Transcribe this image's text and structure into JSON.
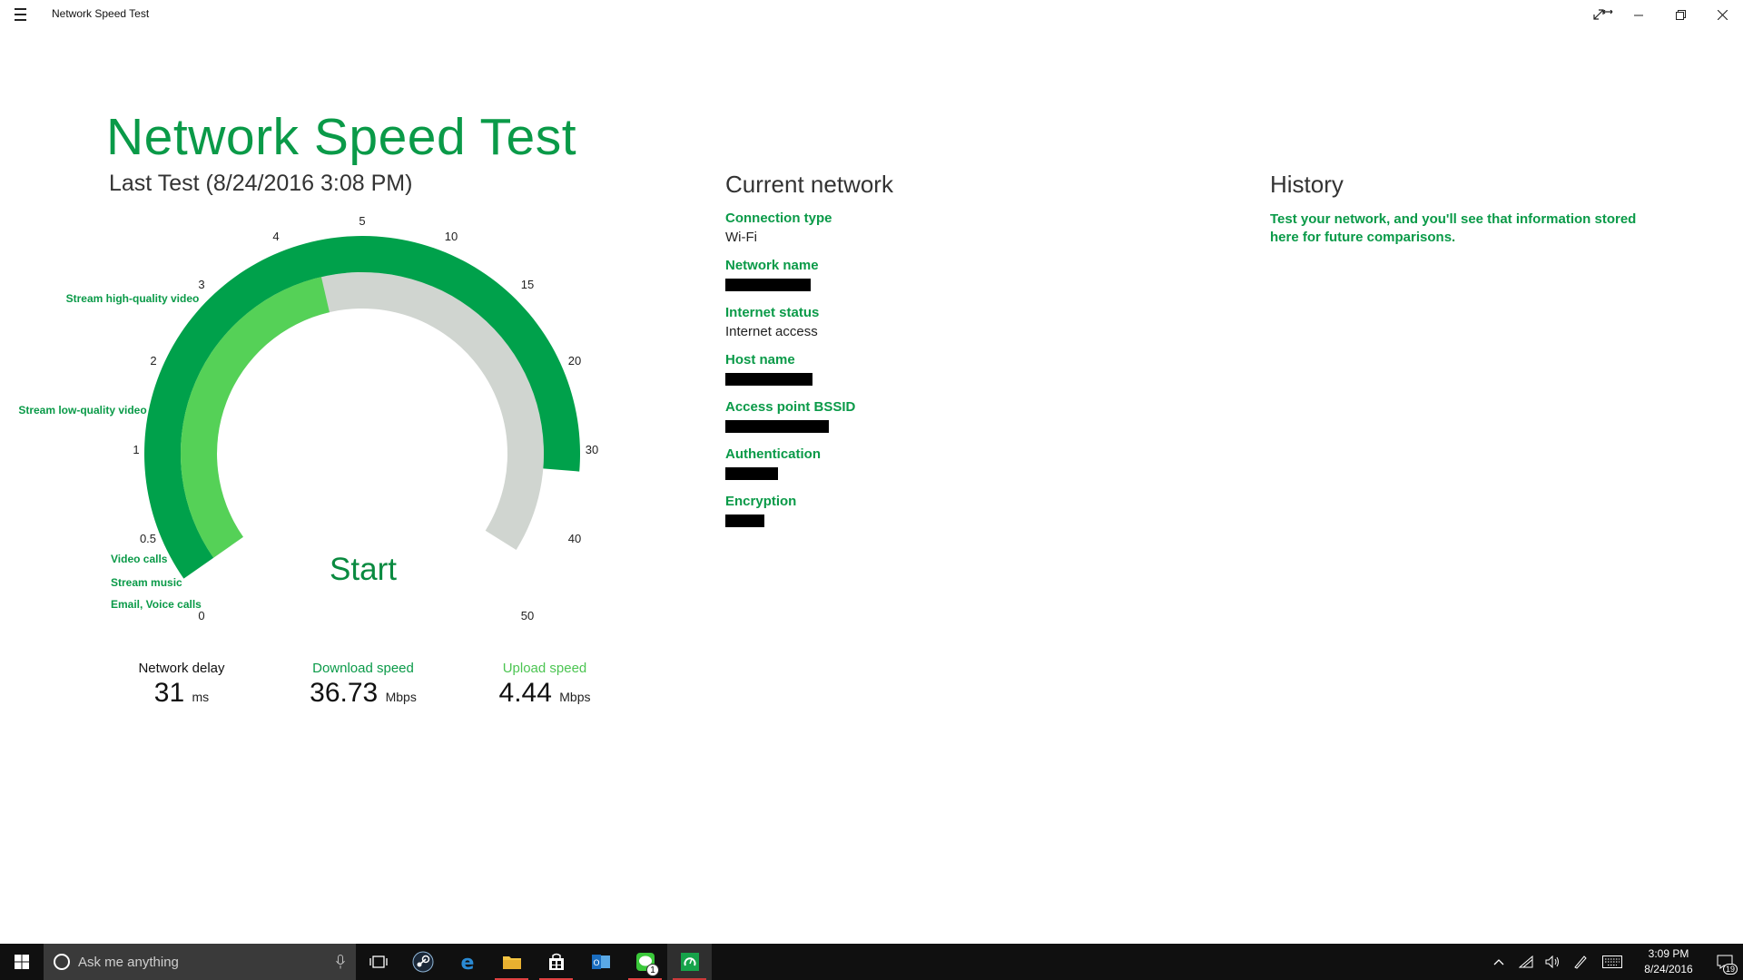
{
  "window": {
    "title": "Network Speed Test",
    "controls": [
      "full-screen",
      "resize",
      "minimize",
      "restore",
      "close"
    ]
  },
  "header": {
    "title": "Network Speed Test",
    "last_test": "Last Test (8/24/2016 3:08 PM)"
  },
  "gauge": {
    "scale_labels": [
      "0",
      "0.5",
      "1",
      "2",
      "3",
      "4",
      "5",
      "10",
      "15",
      "20",
      "30",
      "40",
      "50"
    ],
    "annotations": [
      "Stream high-quality video",
      "Stream low-quality video",
      "Video calls",
      "Stream music",
      "Email, Voice calls"
    ],
    "start_label": "Start",
    "download_mbps": 36.73,
    "upload_mbps": 4.44,
    "colors": {
      "download": "#00a14b",
      "upload": "#55d157",
      "track": "#d0d5d0"
    }
  },
  "stats": {
    "delay": {
      "label": "Network delay",
      "value": "31",
      "unit": "ms"
    },
    "download": {
      "label": "Download speed",
      "value": "36.73",
      "unit": "Mbps"
    },
    "upload": {
      "label": "Upload speed",
      "value": "4.44",
      "unit": "Mbps"
    }
  },
  "network": {
    "title": "Current network",
    "items": [
      {
        "key": "Connection type",
        "value": "Wi-Fi"
      },
      {
        "key": "Network name",
        "value": ""
      },
      {
        "key": "Internet status",
        "value": "Internet access"
      },
      {
        "key": "Host name",
        "value": ""
      },
      {
        "key": "Access point BSSID",
        "value": ""
      },
      {
        "key": "Authentication",
        "value": ""
      },
      {
        "key": "Encryption",
        "value": ""
      }
    ]
  },
  "history": {
    "title": "History",
    "text": "Test your network, and you'll see that information stored here for future comparisons."
  },
  "taskbar": {
    "search_placeholder": "Ask me anything",
    "icons": [
      "windows-start-icon",
      "task-view-icon",
      "steam-icon",
      "edge-icon",
      "file-explorer-icon",
      "store-icon",
      "outlook-icon",
      "line-icon",
      "speed-test-icon"
    ],
    "line_badge": "1",
    "clock_time": "3:09 PM",
    "clock_date": "8/24/2016",
    "notifications": "19"
  }
}
